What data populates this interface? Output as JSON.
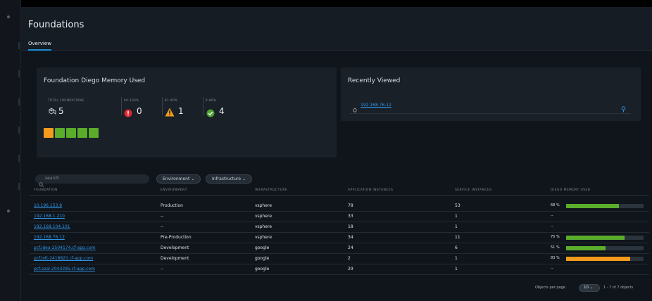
{
  "header": {
    "title": "Foundations",
    "tab": "Overview"
  },
  "memory_card": {
    "title": "Foundation Diego Memory Used",
    "metrics": [
      {
        "label": "TOTAL FOUNDATIONS",
        "value": "5",
        "icon": "foundations-icon"
      },
      {
        "label": "90-100%",
        "value": "0",
        "icon": "error-circle-icon",
        "color": "#e0262f"
      },
      {
        "label": "81-90%",
        "value": "1",
        "icon": "warning-triangle-icon",
        "color": "#f29b1d"
      },
      {
        "label": "0-80%",
        "value": "4",
        "icon": "check-circle-icon",
        "color": "#4da12f"
      }
    ],
    "swatches": [
      "#f29b1d",
      "#5aac2b",
      "#5aac2b",
      "#5aac2b",
      "#5aac2b"
    ]
  },
  "recently_viewed": {
    "title": "Recently Viewed",
    "items": [
      {
        "link": "192.168.76.12"
      }
    ]
  },
  "filters": {
    "search_placeholder": "search",
    "environment": "Environment",
    "infrastructure": "Infrastructure"
  },
  "table": {
    "columns": [
      "FOUNDATION",
      "ENVIRONMENT",
      "INFRASTRUCTURE",
      "APPLICATION INSTANCES",
      "SERVICE INSTANCES",
      "DIEGO MEMORY USED"
    ],
    "rows": [
      {
        "foundation": "10.196.153.8",
        "environment": "Production",
        "infrastructure": "vsphere",
        "app_instances": "78",
        "service_instances": "53",
        "memory": "68 %",
        "memory_fraction": 0.68,
        "memory_color": "#5aac2b"
      },
      {
        "foundation": "192.168.1.210",
        "environment": "--",
        "infrastructure": "vsphere",
        "app_instances": "33",
        "service_instances": "1",
        "memory": "--",
        "memory_fraction": null,
        "memory_color": ""
      },
      {
        "foundation": "192.168.104.101",
        "environment": "--",
        "infrastructure": "vsphere",
        "app_instances": "18",
        "service_instances": "1",
        "memory": "--",
        "memory_fraction": null,
        "memory_color": ""
      },
      {
        "foundation": "192.168.76.12",
        "environment": "Pre-Production",
        "infrastructure": "vsphere",
        "app_instances": "34",
        "service_instances": "11",
        "memory": "75 %",
        "memory_fraction": 0.75,
        "memory_color": "#5aac2b"
      },
      {
        "foundation": "pcf.idea-2504174.cf-app.com",
        "environment": "Development",
        "infrastructure": "google",
        "app_instances": "24",
        "service_instances": "6",
        "memory": "51 %",
        "memory_fraction": 0.51,
        "memory_color": "#5aac2b"
      },
      {
        "foundation": "pcf.jolt-2418821.cf-app.com",
        "environment": "Development",
        "infrastructure": "google",
        "app_instances": "2",
        "service_instances": "1",
        "memory": "83 %",
        "memory_fraction": 0.83,
        "memory_color": "#f29b1d"
      },
      {
        "foundation": "pcf.seal-2043395.cf-app.com",
        "environment": "--",
        "infrastructure": "google",
        "app_instances": "29",
        "service_instances": "1",
        "memory": "--",
        "memory_fraction": null,
        "memory_color": ""
      }
    ]
  },
  "pagination": {
    "label": "Objects per page",
    "per_page": "10",
    "range": "1 - 7 of 7 objects"
  }
}
